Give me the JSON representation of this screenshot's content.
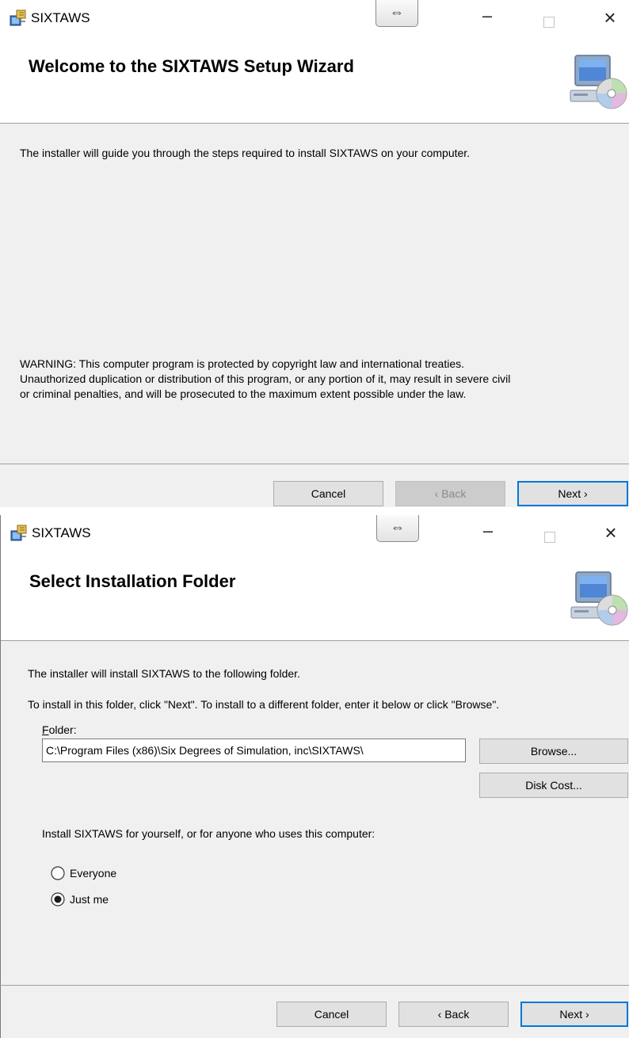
{
  "window1": {
    "title": "SIXTAWS",
    "snap_glyph": "⇔",
    "heading": "Welcome to the SIXTAWS Setup Wizard",
    "intro": "The installer will guide you through the steps required to install SIXTAWS on your computer.",
    "warning_lines": [
      "WARNING: This computer program is protected by copyright law and international treaties.",
      "Unauthorized duplication or distribution of this program, or any portion of it, may result in severe civil",
      "or criminal penalties, and will be prosecuted to the maximum extent possible under the law."
    ],
    "buttons": {
      "cancel": "Cancel",
      "back": "‹ Back",
      "next": "Next ›"
    }
  },
  "window2": {
    "title": "SIXTAWS",
    "snap_glyph": "⇔",
    "heading": "Select Installation Folder",
    "line1": "The installer will install SIXTAWS to the following folder.",
    "line2": "To install in this folder, click \"Next\". To install to a different folder, enter it below or click \"Browse\".",
    "folder_label_accel": "F",
    "folder_label_rest": "older:",
    "folder_value": "C:\\Program Files (x86)\\Six Degrees of Simulation, inc\\SIXTAWS\\",
    "browse": "Browse...",
    "disk_cost": "Disk Cost...",
    "install_for": "Install SIXTAWS for yourself, or for anyone who uses this computer:",
    "options": [
      {
        "label": "Everyone",
        "selected": false
      },
      {
        "label": "Just me",
        "selected": true
      }
    ],
    "buttons": {
      "cancel": "Cancel",
      "back": "‹ Back",
      "next": "Next ›"
    }
  },
  "icons": {
    "app": "installer-package-icon",
    "snap": "snap-layout-icon",
    "minimize": "minimize-icon",
    "maximize": "maximize-icon",
    "close": "close-icon",
    "banner": "computer-cd-icon"
  },
  "colors": {
    "accent": "#0078d7",
    "dialog_bg": "#f0f0f0",
    "banner_bg": "#ffffff"
  }
}
